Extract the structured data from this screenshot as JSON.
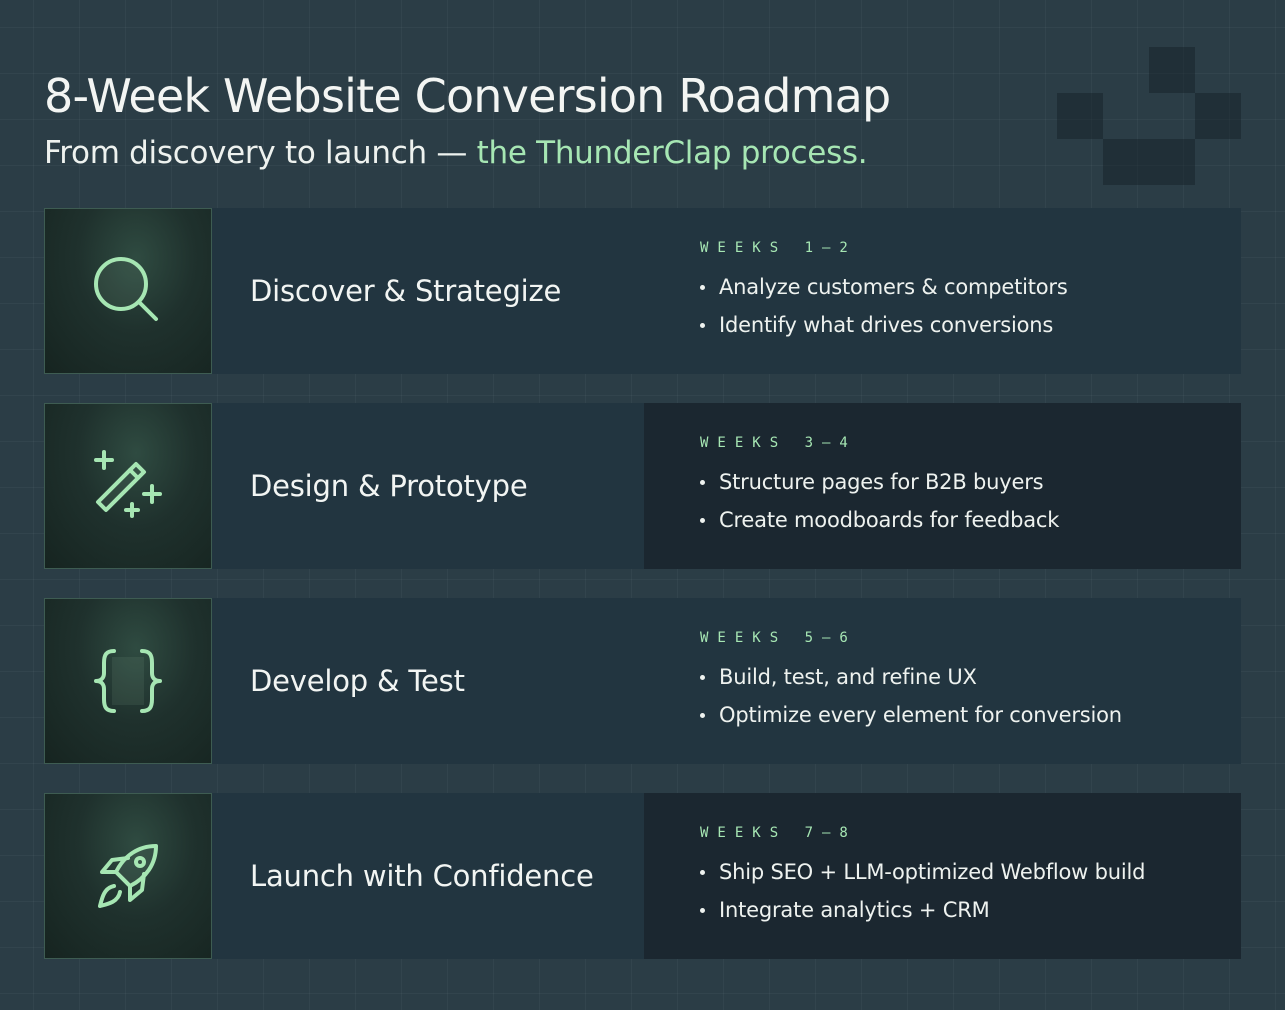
{
  "header": {
    "title": "8-Week Website Conversion Roadmap",
    "subtitle_lead": "From discovery to launch — ",
    "subtitle_accent": "the ThunderClap process."
  },
  "colors": {
    "background": "#2b3d46",
    "accent": "#a6e6b3",
    "panel": "#223540",
    "panel_dark": "#1b2730"
  },
  "phases": [
    {
      "icon": "search-icon",
      "name": "Discover & Strategize",
      "weeks": "WEEKS 1–2",
      "bullets": [
        "Analyze customers & competitors",
        "Identify what drives conversions"
      ]
    },
    {
      "icon": "magic-wand-icon",
      "name": "Design & Prototype",
      "weeks": "WEEKS 3–4",
      "bullets": [
        "Structure pages for B2B buyers",
        "Create moodboards for feedback"
      ]
    },
    {
      "icon": "code-braces-icon",
      "name": "Develop & Test",
      "weeks": "WEEKS 5–6",
      "bullets": [
        "Build, test, and refine UX",
        "Optimize every element for conversion"
      ]
    },
    {
      "icon": "rocket-icon",
      "name": "Launch with Confidence",
      "weeks": "WEEKS 7–8",
      "bullets": [
        "Ship SEO + LLM-optimized Webflow build",
        "Integrate analytics + CRM"
      ]
    }
  ]
}
